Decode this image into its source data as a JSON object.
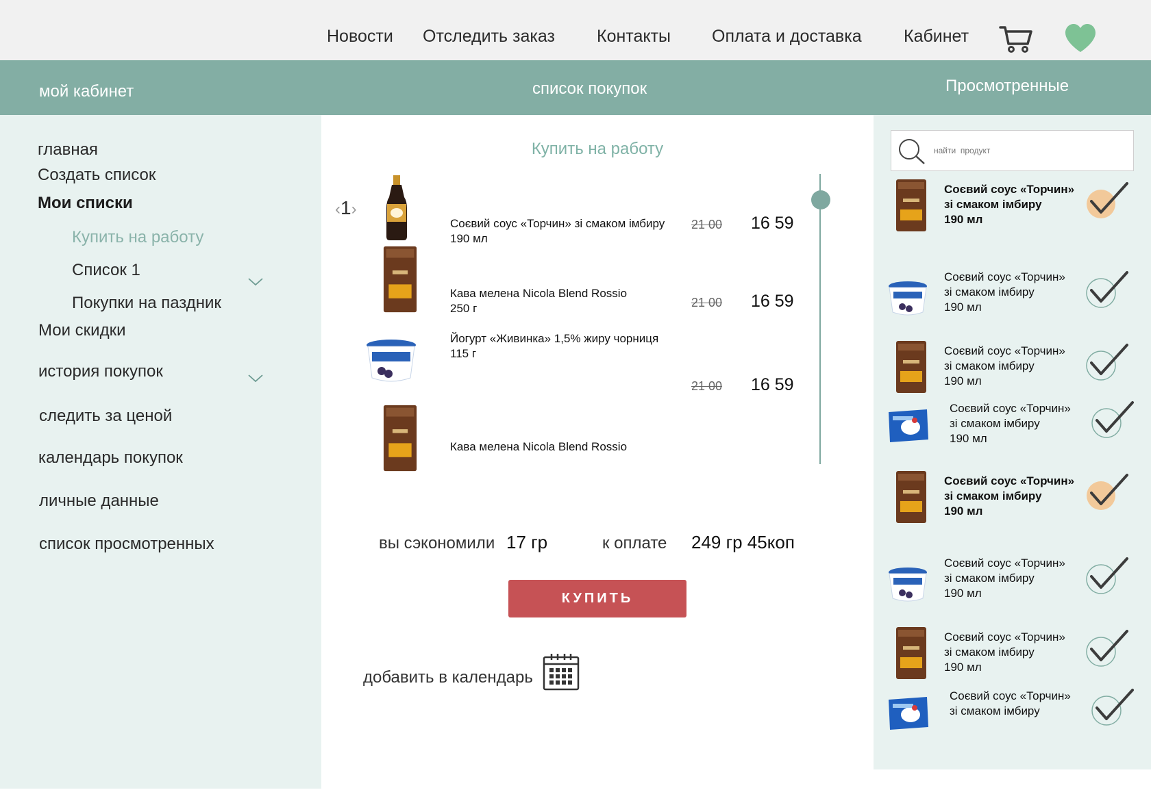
{
  "topnav": {
    "items": [
      "Новости",
      "Отследить заказ",
      "Контакты",
      "Оплата и доставка",
      "Кабинет"
    ]
  },
  "band": {
    "left": "мой кабинет",
    "center": "список покупок",
    "right": "Просмотренные"
  },
  "sidebar": {
    "home": "главная",
    "create": "Создать список",
    "my_lists": "Мои списки",
    "sub": [
      "Купить на работу",
      "Список 1",
      "Покупки на паздник"
    ],
    "discounts": "Мои  скидки",
    "history": "история покупок",
    "price_watch": "следить за ценой",
    "calendar": "календарь покупок",
    "personal": "личные данные",
    "viewed": "список просмотренных"
  },
  "list": {
    "title": "Купить на работу",
    "pager": "1",
    "items": [
      {
        "name": "Соєвий соус «Торчин» зі смаком імбиру",
        "size": "190 мл",
        "old": "21 00",
        "new": "16 59"
      },
      {
        "name": "Кава мелена Nicola Blend Rossio",
        "size": "250 г",
        "old": "21 00",
        "new": "16 59"
      },
      {
        "name": "Йогурт «Живинка» 1,5% жиру чорниця",
        "size": "115 г",
        "old": "21 00",
        "new": "16 59"
      },
      {
        "name": "Кава мелена Nicola Blend Rossio",
        "size": "",
        "old": "",
        "new": ""
      }
    ]
  },
  "summary": {
    "saved_label": "вы сэкономили",
    "saved_value": "17 гр",
    "pay_label": "к оплате",
    "pay_value": "249 гр 45коп",
    "buy_label": "КУПИТЬ",
    "calendar_label": "добавить в календарь"
  },
  "viewed": {
    "search_placeholder": "найти  продукт",
    "cards": [
      {
        "line1": "Соєвий соус «Торчин»",
        "line2": "зі смаком імбиру",
        "line3": "190 мл",
        "bold": true,
        "highlight": true,
        "thumb": "coffee"
      },
      {
        "line1": "Соєвий соус «Торчин»",
        "line2": "зі смаком імбиру",
        "line3": "190 мл",
        "bold": false,
        "highlight": false,
        "thumb": "yogurt"
      },
      {
        "line1": "Соєвий соус «Торчин»",
        "line2": "зі смаком імбиру",
        "line3": "190 мл",
        "bold": false,
        "highlight": false,
        "thumb": "coffee"
      },
      {
        "line1": "Соєвий соус «Торчин»",
        "line2": "зі смаком імбиру",
        "line3": "190 мл",
        "bold": false,
        "highlight": false,
        "thumb": "mozzarella"
      },
      {
        "line1": "Соєвий соус «Торчин»",
        "line2": "зі смаком імбиру",
        "line3": "190 мл",
        "bold": true,
        "highlight": true,
        "thumb": "coffee"
      },
      {
        "line1": "Соєвий соус «Торчин»",
        "line2": "зі смаком імбиру",
        "line3": "190 мл",
        "bold": false,
        "highlight": false,
        "thumb": "yogurt"
      },
      {
        "line1": "Соєвий соус «Торчин»",
        "line2": "зі смаком імбиру",
        "line3": "190 мл",
        "bold": false,
        "highlight": false,
        "thumb": "coffee"
      },
      {
        "line1": "Соєвий соус «Торчин»",
        "line2": "зі смаком імбиру",
        "line3": "",
        "bold": false,
        "highlight": false,
        "thumb": "mozzarella"
      }
    ]
  },
  "colors": {
    "accent": "#83aea4",
    "panel": "#e8f2f0",
    "buy": "#c65255",
    "heart": "#7ec295",
    "check_highlight": "#f2c99a"
  }
}
